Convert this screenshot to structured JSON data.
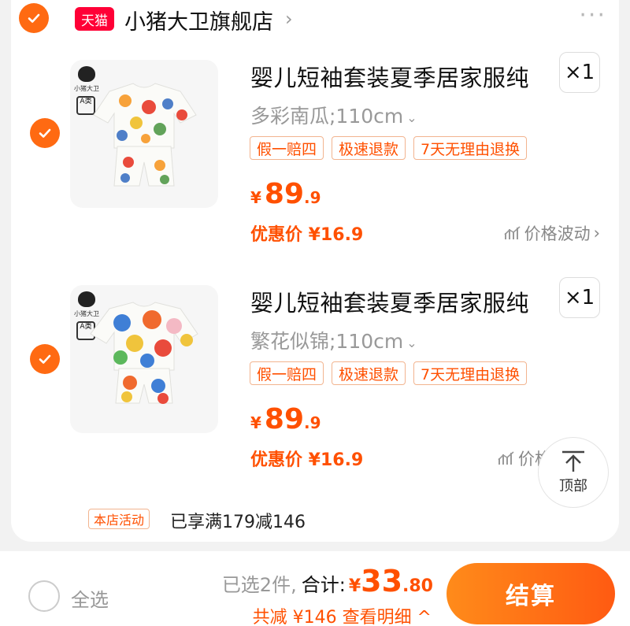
{
  "shop": {
    "badge": "天猫",
    "name": "小猪大卫旗舰店",
    "more": "···"
  },
  "items": [
    {
      "title": "婴儿短袖套装夏季居家服纯",
      "quantity": "×1",
      "spec": "多彩南瓜;110cm",
      "tags": [
        "假一赔四",
        "极速退款",
        "7天无理由退换"
      ],
      "price_currency": "¥",
      "price_int": "89",
      "price_dec": ".9",
      "promo": "优惠价 ¥16.9",
      "trend": "价格波动",
      "checked": true
    },
    {
      "title": "婴儿短袖套装夏季居家服纯",
      "quantity": "×1",
      "spec": "繁花似锦;110cm",
      "tags": [
        "假一赔四",
        "极速退款",
        "7天无理由退换"
      ],
      "price_currency": "¥",
      "price_int": "89",
      "price_dec": ".9",
      "promo": "优惠价 ¥16.9",
      "trend": "价格",
      "checked": true
    }
  ],
  "activity": {
    "tag": "本店活动",
    "text": "已享满179减146"
  },
  "back_to_top": {
    "label": "顶部"
  },
  "footer": {
    "select_all": "全选",
    "selected": "已选2件,",
    "total_label": "合计:",
    "total_currency": "¥",
    "total_int": "33",
    "total_dec": ".80",
    "discount": "共减 ¥146  查看明细 ^",
    "checkout": "结算"
  },
  "colors": {
    "accent": "#ff5000",
    "check": "#ff6a12",
    "tmall": "#ff0036"
  },
  "brand_mark": {
    "pig": "小猪大卫",
    "a_class": "A类"
  }
}
